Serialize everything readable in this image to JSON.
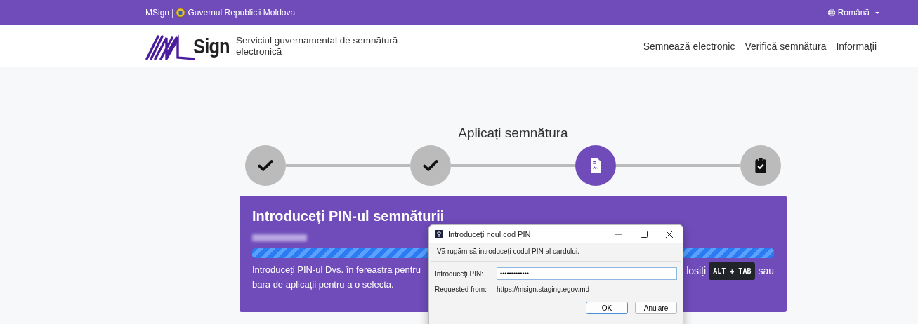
{
  "top_bar": {
    "brand": "MSign |",
    "government": "Guvernul Republicii Moldova",
    "language": "Română"
  },
  "header": {
    "logo_text": "Sign",
    "tagline": "Serviciul guvernamental de semnătură electronică",
    "nav": [
      {
        "label": "Semnează electronic"
      },
      {
        "label": "Verifică semnătura"
      },
      {
        "label": "Informații"
      }
    ]
  },
  "page_title": "Aplicați semnătura",
  "steps": [
    {
      "kind": "done"
    },
    {
      "kind": "done"
    },
    {
      "kind": "current"
    },
    {
      "kind": "pending"
    }
  ],
  "card": {
    "title": "Introduceți PIN-ul semnăturii",
    "progress": {
      "level": 1
    },
    "text_left": [
      "Introduceți PIN-ul Dvs. în fereastra pentru",
      "bara de aplicații pentru a o selecta."
    ],
    "text_right_before": "losiți",
    "shortcut": "ALT + TAB",
    "text_right_after": "sau"
  },
  "dialog": {
    "title": "Introduceți noul cod PIN",
    "message": "Vă rugăm să introduceți codul PIN al cardului.",
    "pin_label": "Introduceți PIN:",
    "pin_value": "•••••••••••••",
    "requested_label": "Requested from:",
    "requested_url": "https://msign.staging.egov.md",
    "buttons": [
      {
        "label": "OK",
        "default": true
      },
      {
        "label": "Anulare",
        "default": false
      }
    ]
  }
}
